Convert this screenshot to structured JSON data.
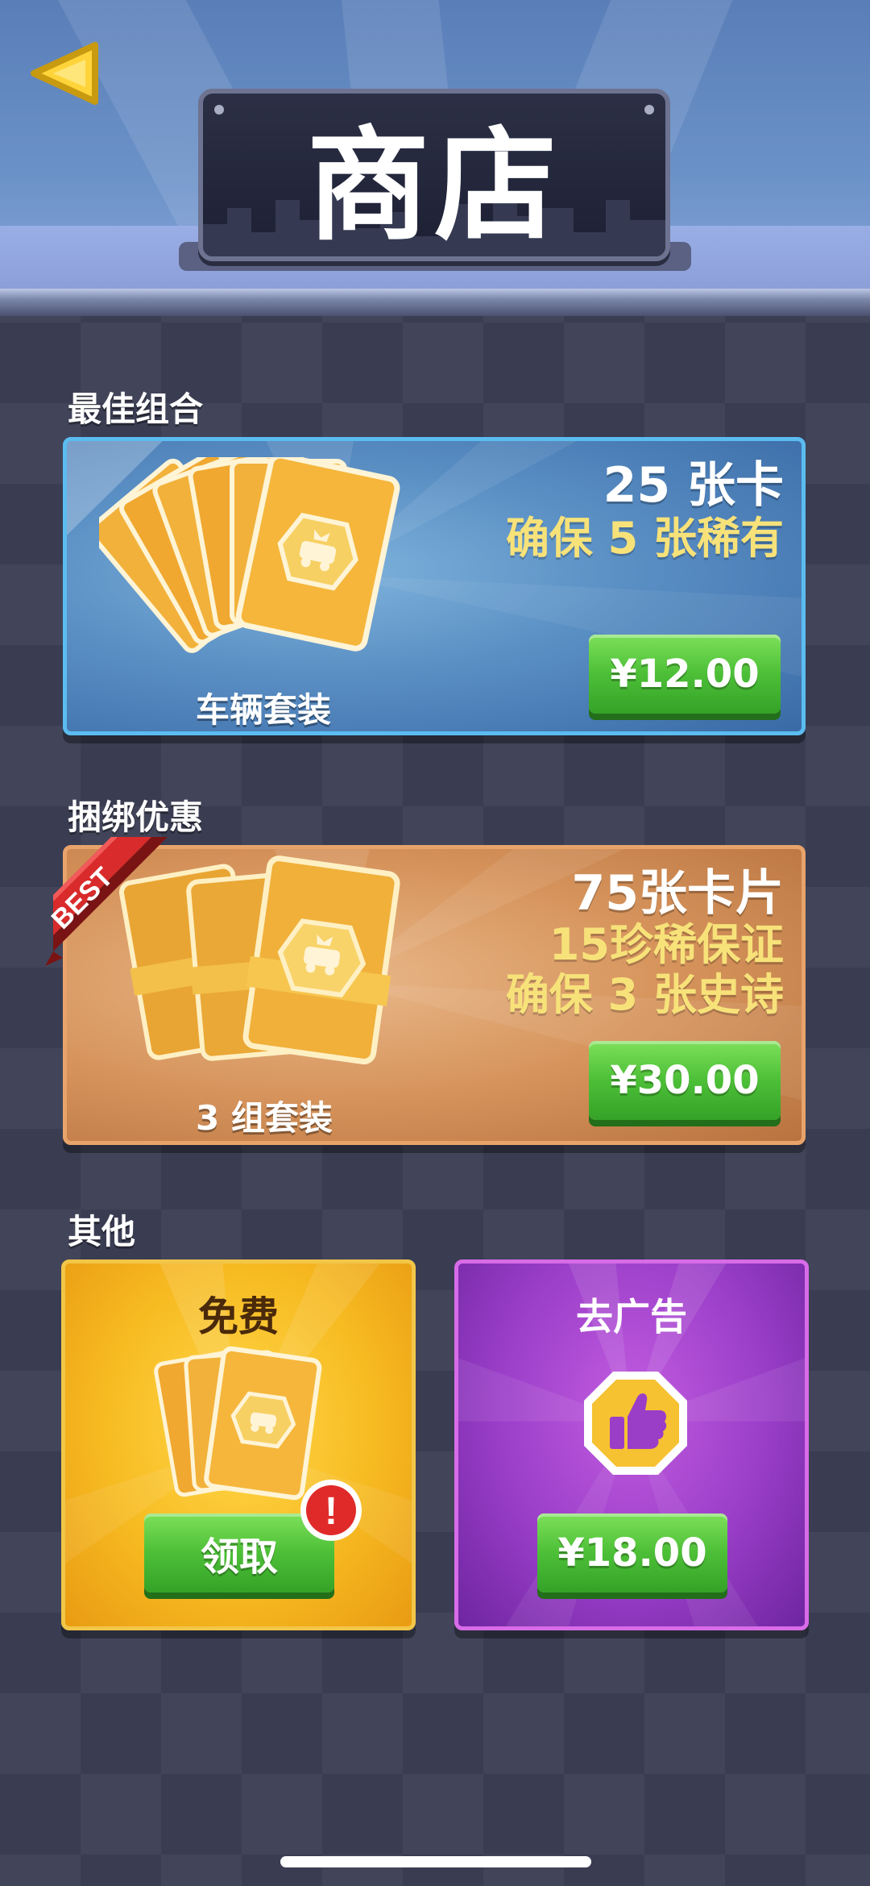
{
  "header": {
    "title": "商店"
  },
  "sections": {
    "best": {
      "label": "最佳组合",
      "count_line": "25 张卡",
      "guarantee_line": "确保 5 张稀有",
      "pack_label": "车辆套装",
      "price": "¥12.00"
    },
    "bundle": {
      "label": "捆绑优惠",
      "badge": "BEST",
      "count_line": "75张卡片",
      "rare_line": "15珍稀保证",
      "epic_line": "确保 3 张史诗",
      "pack_label": "3 组套装",
      "price": "¥30.00"
    },
    "other": {
      "label": "其他",
      "free": {
        "title": "免费",
        "button": "领取",
        "alert": "!"
      },
      "no_ads": {
        "title": "去广告",
        "price": "¥18.00"
      }
    }
  },
  "colors": {
    "price_green": "#4cbf37",
    "best_border": "#5bbcf0",
    "bundle_border": "#e8a36a",
    "free_bg": "#f7bb22",
    "noads_bg": "#9a3ec8",
    "guarantee_yellow": "#f7e27a",
    "alert_red": "#e02a2a"
  },
  "icons": [
    "back-arrow-icon",
    "card-pack-icon",
    "car-emblem-icon",
    "thumbs-up-icon",
    "alert-icon"
  ]
}
